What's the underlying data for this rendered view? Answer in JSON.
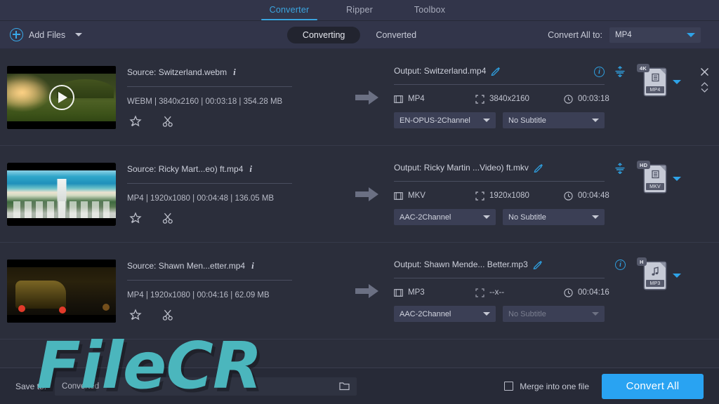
{
  "nav": {
    "tabs": [
      {
        "label": "Converter",
        "active": true
      },
      {
        "label": "Ripper",
        "active": false
      },
      {
        "label": "Toolbox",
        "active": false
      }
    ]
  },
  "toolbar": {
    "add_files_label": "Add Files",
    "add_files_icon": "plus-circle-icon",
    "add_files_caret_icon": "caret-down-icon",
    "segments": [
      {
        "label": "Converting",
        "active": true
      },
      {
        "label": "Converted",
        "active": false
      }
    ],
    "convert_all_to_label": "Convert All to:",
    "convert_all_to_value": "MP4"
  },
  "rows": [
    {
      "thumbnail_name": "thumbnail-switzerland",
      "has_play_overlay": true,
      "source": {
        "title": "Source: Switzerland.webm",
        "info_icon": "info-italic-icon",
        "meta": "WEBM | 3840x2160 | 00:03:18 | 354.28 MB",
        "tools": [
          "effect-icon",
          "trim-scissors-icon"
        ]
      },
      "arrow_icon": "arrow-right-icon",
      "output": {
        "title": "Output: Switzerland.mp4",
        "edit_icon": "pencil-icon",
        "format": "MP4",
        "format_icon": "film-icon",
        "resolution": "3840x2160",
        "resolution_icon": "resize-icon",
        "duration": "00:03:18",
        "duration_icon": "clock-icon",
        "audio_track": "EN-OPUS-2Channel",
        "subtitle_track": "No Subtitle",
        "subtitle_disabled": false,
        "show_info": true,
        "show_merge": true,
        "info_icon": "info-circle-icon",
        "merge_icon": "merge-icon"
      },
      "badge": {
        "quality": "4K",
        "format_label": "MP4",
        "glyph": "film-icon",
        "caret_icon": "caret-down-icon"
      },
      "controls": {
        "close_icon": "close-x-icon",
        "reorder_icon": "reorder-updown-icon",
        "show": true
      }
    },
    {
      "thumbnail_name": "thumbnail-ricky-martin",
      "has_play_overlay": false,
      "source": {
        "title": "Source: Ricky Mart...eo) ft.mp4",
        "info_icon": "info-italic-icon",
        "meta": "MP4 | 1920x1080 | 00:04:48 | 136.05 MB",
        "tools": [
          "effect-icon",
          "trim-scissors-icon"
        ]
      },
      "arrow_icon": "arrow-right-icon",
      "output": {
        "title": "Output: Ricky Martin ...Video) ft.mkv",
        "edit_icon": "pencil-icon",
        "format": "MKV",
        "format_icon": "film-icon",
        "resolution": "1920x1080",
        "resolution_icon": "resize-icon",
        "duration": "00:04:48",
        "duration_icon": "clock-icon",
        "audio_track": "AAC-2Channel",
        "subtitle_track": "No Subtitle",
        "subtitle_disabled": false,
        "show_info": false,
        "show_merge": true,
        "info_icon": "info-circle-icon",
        "merge_icon": "merge-icon"
      },
      "badge": {
        "quality": "HD",
        "format_label": "MKV",
        "glyph": "film-icon",
        "caret_icon": "caret-down-icon"
      },
      "controls": {
        "close_icon": "close-x-icon",
        "reorder_icon": "reorder-updown-icon",
        "show": false
      }
    },
    {
      "thumbnail_name": "thumbnail-shawn-mendes",
      "has_play_overlay": false,
      "source": {
        "title": "Source: Shawn Men...etter.mp4",
        "info_icon": "info-italic-icon",
        "meta": "MP4 | 1920x1080 | 00:04:16 | 62.09 MB",
        "tools": [
          "effect-icon",
          "trim-scissors-icon"
        ]
      },
      "arrow_icon": "arrow-right-icon",
      "output": {
        "title": "Output: Shawn Mende... Better.mp3",
        "edit_icon": "pencil-icon",
        "format": "MP3",
        "format_icon": "film-icon",
        "resolution": "--x--",
        "resolution_icon": "resize-icon",
        "duration": "00:04:16",
        "duration_icon": "clock-icon",
        "audio_track": "AAC-2Channel",
        "subtitle_track": "No Subtitle",
        "subtitle_disabled": true,
        "show_info": true,
        "show_merge": false,
        "info_icon": "info-circle-icon",
        "merge_icon": "merge-icon"
      },
      "badge": {
        "quality": "H",
        "format_label": "MP3",
        "glyph": "music-note-icon",
        "caret_icon": "caret-down-icon"
      },
      "controls": {
        "close_icon": "close-x-icon",
        "reorder_icon": "reorder-updown-icon",
        "show": false
      }
    }
  ],
  "bottom": {
    "save_to_label": "Save to:",
    "save_to_value": "Converted",
    "folder_icon": "folder-icon",
    "merge_checkbox_label": "Merge into one file",
    "merge_checked": false,
    "convert_all_button": "Convert All"
  },
  "watermark": {
    "text": "FileCR",
    "color": "#4bb6bd"
  },
  "theme": {
    "accent": "#29a3f2",
    "tab_accent": "#3ba5e0",
    "background": "#2b2e3b",
    "panel": "#32354a",
    "bottom_bar": "#272a37",
    "control": "#3b3f55"
  }
}
